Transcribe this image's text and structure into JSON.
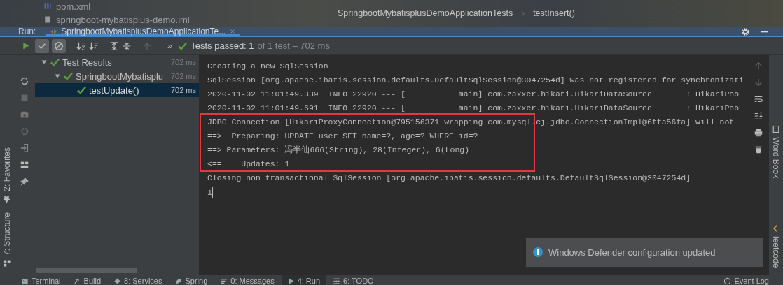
{
  "project_tree": [
    {
      "label": "pom.xml",
      "kind": "maven"
    },
    {
      "label": "springboot-mybatisplus-demo.iml",
      "kind": "module"
    }
  ],
  "breadcrumb": [
    "SpringbootMybatisplusDemoApplicationTests",
    "testInsert()"
  ],
  "run_panel": {
    "label": "Run:",
    "tab": {
      "title": "SpringbootMybatisplusDemoApplicationTe...",
      "selected": true
    }
  },
  "toolbar": [
    {
      "kind": "toggle-passed",
      "selected": true
    },
    {
      "kind": "toggle-ignored",
      "selected": true
    }
  ],
  "test_status": {
    "more": "»",
    "summary": "Tests passed: 1",
    "detail": "of 1 test – 702 ms"
  },
  "test_tree": [
    {
      "label": "Test Results",
      "time": "702 ms",
      "passed": true,
      "expanded": true,
      "selected": false,
      "children": [
        {
          "label": "SpringbootMybatisplu",
          "time": "702 ms",
          "passed": true,
          "expanded": true,
          "selected": false,
          "children": [
            {
              "label": "testUpdate()",
              "time": "702 ms",
              "passed": true,
              "selected": true
            }
          ]
        }
      ]
    }
  ],
  "side_tabs_left": [
    {
      "label": "2: Favorites",
      "kind": "star"
    },
    {
      "label": "7: Structure",
      "kind": "structure"
    }
  ],
  "side_tabs_right": [
    {
      "label": "Word Book",
      "kind": "book"
    },
    {
      "label": "leetcode",
      "kind": "leetcode"
    }
  ],
  "console": {
    "lines_before": [
      "Creating a new SqlSession",
      "SqlSession [org.apache.ibatis.session.defaults.DefaultSqlSession@3047254d] was not registered for synchronizati",
      "2020-11-02 11:01:49.339  INFO 22920 --- [           main] com.zaxxer.hikari.HikariDataSource       : HikariPoo",
      "2020-11-02 11:01:49.691  INFO 22920 --- [           main] com.zaxxer.hikari.HikariDataSource       : HikariPoo"
    ],
    "highlighted_lines": [
      "JDBC Connection [HikariProxyConnection@795156371 wrapping com.mysql.cj.jdbc.ConnectionImpl@6ffa56fa] will not",
      "==>  Preparing: UPDATE user SET name=?, age=? WHERE id=?",
      "==> Parameters: 冯半仙666(String), 28(Integer), 6(Long)",
      "<==    Updates: 1"
    ],
    "lines_after": [
      "Closing non transactional SqlSession [org.apache.ibatis.session.defaults.DefaultSqlSession@3047254d]"
    ],
    "input_line": "1"
  },
  "notification": {
    "message": "Windows Defender configuration updated"
  },
  "bottom_tabs": [
    {
      "label": "Terminal",
      "kind": "terminal",
      "selected": false
    },
    {
      "label": "Build",
      "kind": "build",
      "selected": false
    },
    {
      "label": "8: Services",
      "kind": "services",
      "selected": false
    },
    {
      "label": "Spring",
      "kind": "spring",
      "selected": false
    },
    {
      "label": "0: Messages",
      "kind": "messages",
      "selected": false
    },
    {
      "label": "4: Run",
      "kind": "run",
      "selected": true
    },
    {
      "label": "6: TODO",
      "kind": "todo",
      "selected": false
    }
  ],
  "event_log": {
    "label": "Event Log"
  }
}
